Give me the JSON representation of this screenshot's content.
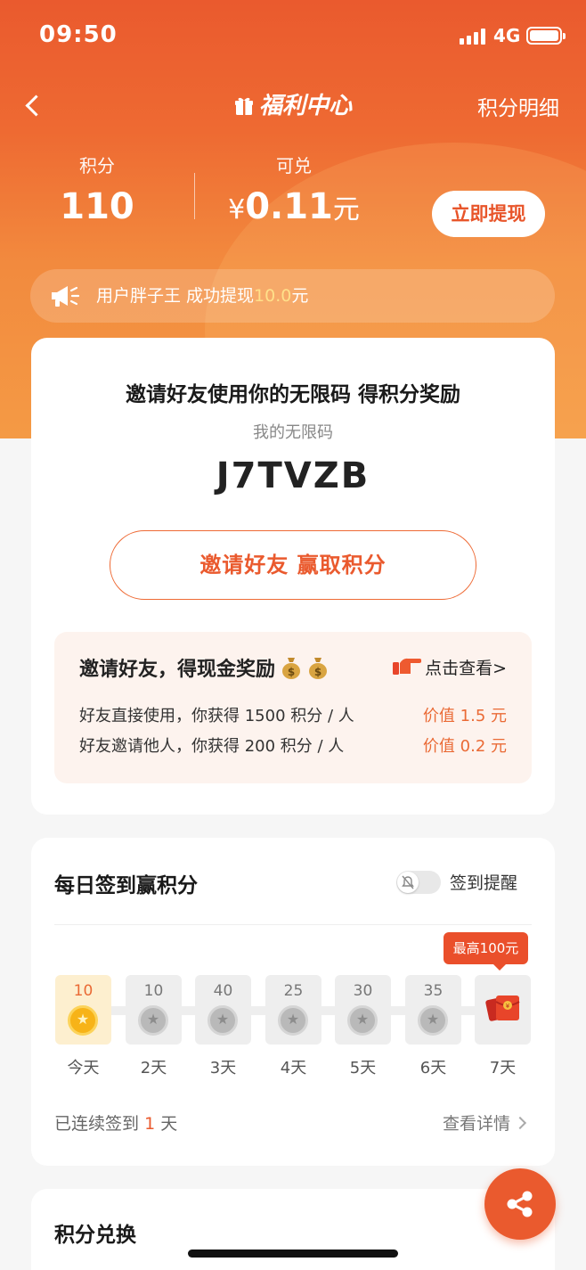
{
  "status_bar": {
    "time": "09:50",
    "network": "4G"
  },
  "nav": {
    "title": "福利中心",
    "right_link": "积分明细"
  },
  "points": {
    "points_label": "积分",
    "points_value": "110",
    "exchange_label": "可兑",
    "exchange_currency": "¥",
    "exchange_value": "0.11",
    "exchange_unit": "元",
    "withdraw_button": "立即提现"
  },
  "notice": {
    "prefix": "用户胖子王 成功提现",
    "amount": "10.0",
    "suffix": "元"
  },
  "invite": {
    "title": "邀请好友使用你的无限码 得积分奖励",
    "code_label": "我的无限码",
    "code": "J7TVZB",
    "button": "邀请好友 赢取积分",
    "reward_title": "邀请好友，得现金奖励",
    "reward_link": "点击查看>",
    "rows": [
      {
        "text": "好友直接使用，你获得 1500 积分 / 人",
        "value": "价值 1.5 元"
      },
      {
        "text": "好友邀请他人，你获得 200 积分 / 人",
        "value": "价值 0.2 元"
      }
    ]
  },
  "checkin": {
    "title": "每日签到赢积分",
    "remind_label": "签到提醒",
    "remind_on": false,
    "max_badge": "最高100元",
    "days": [
      {
        "points": "10",
        "label": "今天"
      },
      {
        "points": "10",
        "label": "2天"
      },
      {
        "points": "40",
        "label": "3天"
      },
      {
        "points": "25",
        "label": "4天"
      },
      {
        "points": "30",
        "label": "5天"
      },
      {
        "points": "35",
        "label": "6天"
      },
      {
        "points": "",
        "label": "7天"
      }
    ],
    "streak_prefix": "已连续签到",
    "streak_count": "1",
    "streak_suffix": "天",
    "more_link": "查看详情"
  },
  "exchange": {
    "title": "积分兑换"
  },
  "colors": {
    "brand": "#ea5a2e",
    "accent_text": "#ea6a35",
    "highlight": "#ffe08a"
  },
  "icons": [
    "back-icon",
    "gift-icon",
    "megaphone-icon",
    "moneybag-icon",
    "pointing-hand-icon",
    "bell-off-icon",
    "coin-star-icon",
    "red-envelope-icon",
    "share-icon",
    "chevron-right-icon"
  ]
}
